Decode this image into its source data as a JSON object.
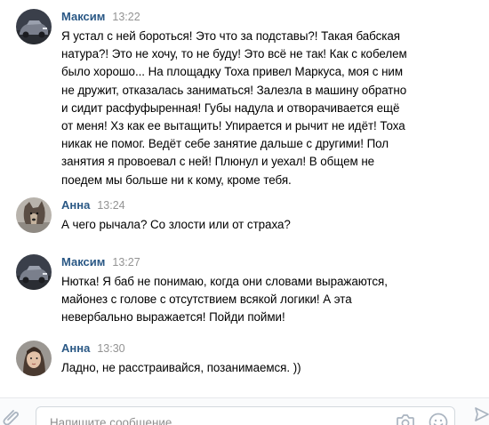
{
  "messages": [
    {
      "author": "Максим",
      "time": "13:22",
      "avatar_icon": "car-avatar",
      "text": "Я устал с ней бороться! Это что за подставы?! Такая бабская\nнатура?! Это не хочу, то не буду! Это всё не так! Как с кобелем\nбыло хорошо... На площадку Тоха привел Маркуса, моя с ним\nне дружит, отказалась заниматься! Залезла в машину обратно\nи сидит расфуфыренная! Губы надула и отворачивается ещё\nот меня! Хз как ее вытащить! Упирается и рычит не идёт! Тоха\nникак не помог. Ведёт себе занятие дальше с другими! Пол\nзанятия я провоевал с ней! Плюнул и уехал! В общем не\nпоедем мы больше ни к кому, кроме тебя."
    },
    {
      "author": "Анна",
      "time": "13:24",
      "avatar_icon": "dog-avatar",
      "text": "А чего рычала? Со злости или от страха?"
    },
    {
      "author": "Максим",
      "time": "13:27",
      "avatar_icon": "car-avatar",
      "text": "Нютка! Я баб не понимаю, когда они словами выражаются,\nмайонез с голове с отсутствием всякой логики! А эта\nневербально выражается! Пойди пойми!"
    },
    {
      "author": "Анна",
      "time": "13:30",
      "avatar_icon": "woman-avatar",
      "text": "Ладно, не расстраивайся, позанимаемся. ))"
    }
  ],
  "composer": {
    "placeholder": "Напишите сообщение...",
    "icons": [
      "paperclip-icon",
      "camera-icon",
      "smile-icon",
      "send-icon"
    ]
  },
  "colors": {
    "author": "#2a5885",
    "time": "#939393",
    "placeholder": "#8e8e8e",
    "icon": "#aab4c0"
  }
}
